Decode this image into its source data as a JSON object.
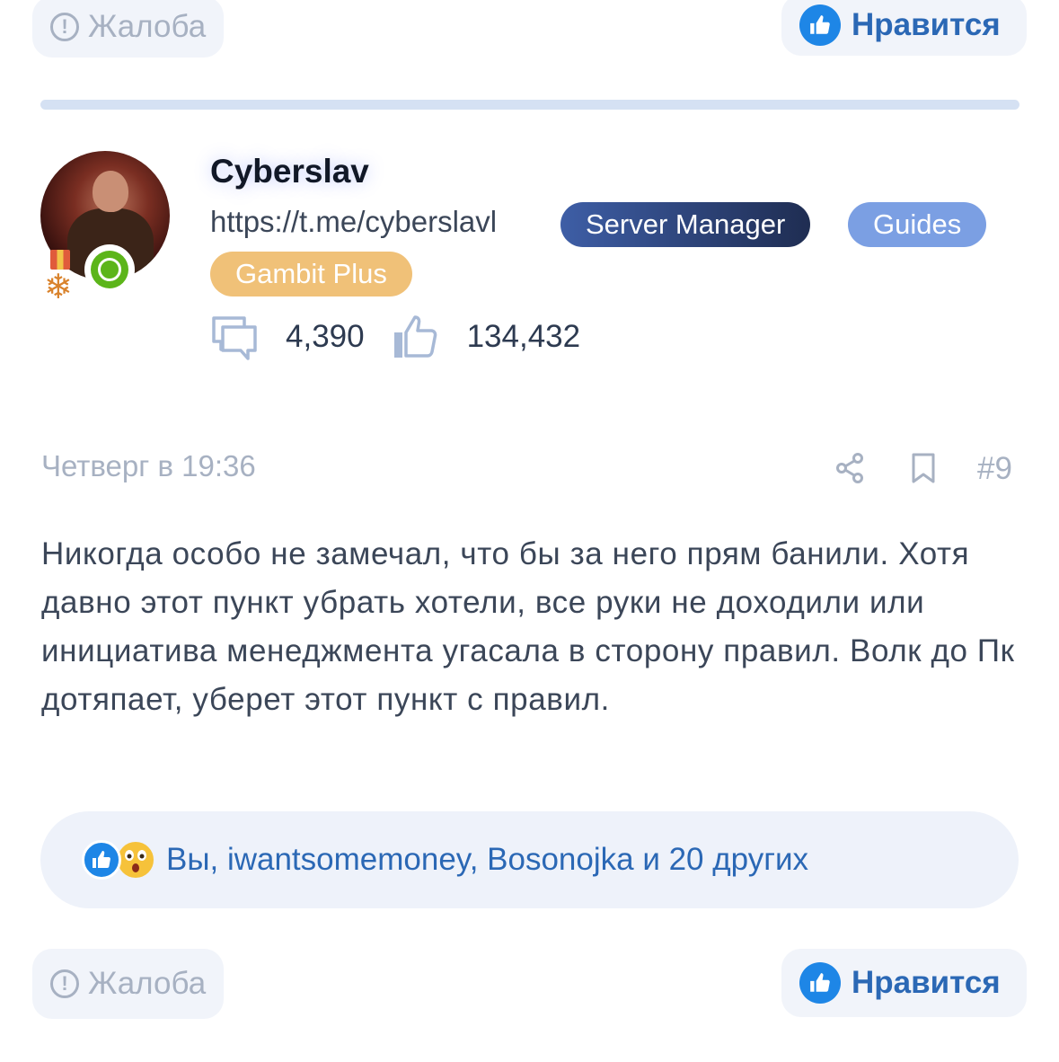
{
  "prev_post_actions": {
    "report_label": "Жалоба",
    "like_label": "Нравится"
  },
  "author": {
    "name": "Cyberslav",
    "link": "https://t.me/cyberslavl",
    "badges": [
      "Server Manager",
      "Guides",
      "Gambit Plus"
    ],
    "messages_count": "4,390",
    "likes_count": "134,432",
    "status": "online"
  },
  "post": {
    "date": "Четверг в 19:36",
    "number": "#9",
    "body": "Никогда особо не замечал, что бы за него прям банили. Хотя давно этот пункт убрать хотели, все руки не доходили или инициатива менеджмента угасала в сторону правил. Волк до Пк дотяпает, уберет этот пункт с правил.",
    "reactions_text": "Вы, iwantsomemoney, Bosonojka и 20 других",
    "icons": [
      "share-icon",
      "bookmark-icon"
    ]
  },
  "post_actions": {
    "report_label": "Жалоба",
    "like_label": "Нравится"
  },
  "colors": {
    "accent": "#2b68b5",
    "like_blue": "#1e86e6",
    "muted": "#a7b1c2",
    "badge_server": "#2d4278",
    "badge_guides": "#7b9fe3",
    "badge_gambit": "#f0c178",
    "online": "#5cb51a"
  }
}
